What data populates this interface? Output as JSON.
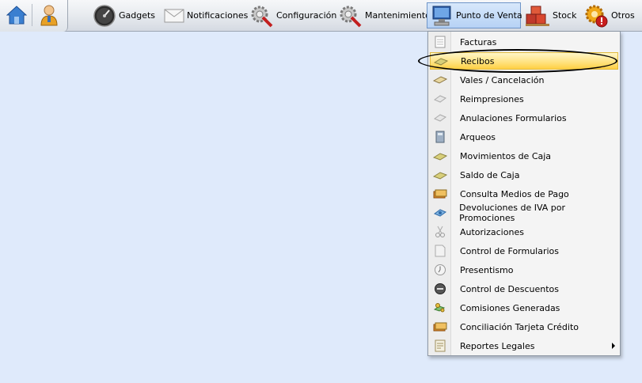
{
  "toolbar": {
    "items": [
      {
        "label": "Gadgets",
        "icon": "gauge-icon"
      },
      {
        "label": "Notificaciones",
        "icon": "envelope-icon"
      },
      {
        "label": "Configuración",
        "icon": "gear-wrench-icon"
      },
      {
        "label": "Mantenimiento",
        "icon": "gear-wrench-icon"
      },
      {
        "label": "Punto de Venta",
        "icon": "computer-icon",
        "active": true
      },
      {
        "label": "Stock",
        "icon": "boxes-icon"
      },
      {
        "label": "Otros",
        "icon": "gear-alert-icon"
      }
    ]
  },
  "menu": {
    "items": [
      {
        "label": "Facturas",
        "icon": "document-icon"
      },
      {
        "label": "Recibos",
        "icon": "money-icon",
        "highlighted": true
      },
      {
        "label": "Vales / Cancelación",
        "icon": "voucher-icon"
      },
      {
        "label": "Reimpresiones",
        "icon": "reprint-icon"
      },
      {
        "label": "Anulaciones Formularios",
        "icon": "reprint-icon"
      },
      {
        "label": "Arqueos",
        "icon": "calculator-icon"
      },
      {
        "label": "Movimientos de Caja",
        "icon": "money-icon"
      },
      {
        "label": "Saldo de Caja",
        "icon": "money-icon"
      },
      {
        "label": "Consulta Medios de Pago",
        "icon": "cards-icon"
      },
      {
        "label": "Devoluciones de IVA por Promociones",
        "icon": "refund-icon"
      },
      {
        "label": "Autorizaciones",
        "icon": "scissors-icon"
      },
      {
        "label": "Control de Formularios",
        "icon": "form-icon"
      },
      {
        "label": "Presentismo",
        "icon": "clock-icon"
      },
      {
        "label": "Control de Descuentos",
        "icon": "sale-tag-icon"
      },
      {
        "label": "Comisiones Generadas",
        "icon": "coins-icon"
      },
      {
        "label": "Conciliación Tarjeta Crédito",
        "icon": "cards-icon"
      },
      {
        "label": "Reportes Legales",
        "icon": "report-icon",
        "has_submenu": true
      }
    ]
  }
}
